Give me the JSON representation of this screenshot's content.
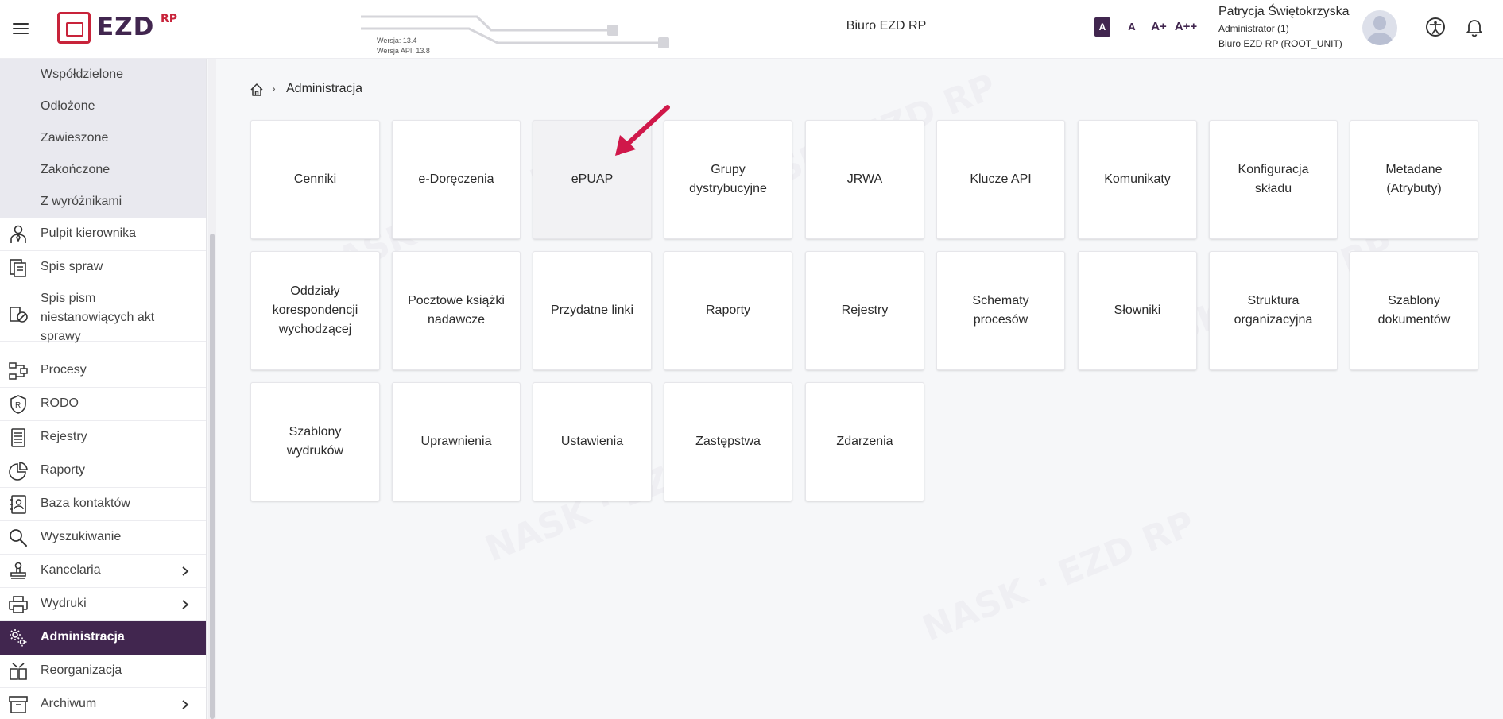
{
  "header": {
    "app_logo_text": "EZD",
    "app_logo_sup": "RP",
    "version": "Wersja: 13.4",
    "version_api": "Wersja API: 13.8",
    "organization": "Biuro EZD RP",
    "font_sizes": [
      "A",
      "A",
      "A+",
      "A++"
    ],
    "user": {
      "name": "Patrycja Świętokrzyska",
      "role": "Administrator (1)",
      "unit": "Biuro EZD RP (ROOT_UNIT)"
    },
    "icons": [
      "hamburger-icon",
      "accessibility-icon",
      "bell-icon"
    ]
  },
  "sidebar": {
    "sub_items": [
      "Współdzielone",
      "Odłożone",
      "Zawieszone",
      "Zakończone",
      "Z wyróżnikami"
    ],
    "items": [
      {
        "label": "Pulpit kierownika",
        "icon": "manager-icon",
        "chevron": false
      },
      {
        "label": "Spis spraw",
        "icon": "cases-icon",
        "chevron": false
      },
      {
        "label_lines": [
          "Spis pism",
          "niestanowiących akt",
          "sprawy"
        ],
        "icon": "documents-icon",
        "chevron": false
      },
      {
        "label": "Procesy",
        "icon": "process-icon",
        "chevron": false
      },
      {
        "label": "RODO",
        "icon": "shield-icon",
        "chevron": false
      },
      {
        "label": "Rejestry",
        "icon": "register-icon",
        "chevron": false
      },
      {
        "label": "Raporty",
        "icon": "pie-chart-icon",
        "chevron": false
      },
      {
        "label": "Baza kontaktów",
        "icon": "contacts-icon",
        "chevron": false
      },
      {
        "label": "Wyszukiwanie",
        "icon": "search-icon",
        "chevron": false
      },
      {
        "label": "Kancelaria",
        "icon": "stamp-icon",
        "chevron": true
      },
      {
        "label": "Wydruki",
        "icon": "printer-icon",
        "chevron": true
      },
      {
        "label": "Administracja",
        "icon": "gear-icon",
        "chevron": false,
        "active": true
      },
      {
        "label": "Reorganizacja",
        "icon": "reorganize-icon",
        "chevron": false
      },
      {
        "label": "Archiwum",
        "icon": "archive-icon",
        "chevron": true
      }
    ],
    "active_color": "#41264f"
  },
  "breadcrumb": {
    "separator": "›",
    "current": "Administracja"
  },
  "tiles": [
    {
      "lines": [
        "Cenniki"
      ]
    },
    {
      "lines": [
        "e-Doręczenia"
      ]
    },
    {
      "lines": [
        "ePUAP"
      ],
      "hover": true
    },
    {
      "lines": [
        "Grupy",
        "dystrybucyjne"
      ]
    },
    {
      "lines": [
        "JRWA"
      ]
    },
    {
      "lines": [
        "Klucze API"
      ]
    },
    {
      "lines": [
        "Komunikaty"
      ]
    },
    {
      "lines": [
        "Konfiguracja",
        "składu"
      ]
    },
    {
      "lines": [
        "Metadane",
        "(Atrybuty)"
      ]
    },
    {
      "lines": [
        "Oddziały",
        "korespondencji",
        "wychodzącej"
      ]
    },
    {
      "lines": [
        "Pocztowe książki",
        "nadawcze"
      ]
    },
    {
      "lines": [
        "Przydatne linki"
      ]
    },
    {
      "lines": [
        "Raporty"
      ]
    },
    {
      "lines": [
        "Rejestry"
      ]
    },
    {
      "lines": [
        "Schematy",
        "procesów"
      ]
    },
    {
      "lines": [
        "Słowniki"
      ]
    },
    {
      "lines": [
        "Struktura",
        "organizacyjna"
      ]
    },
    {
      "lines": [
        "Szablony",
        "dokumentów"
      ]
    },
    {
      "lines": [
        "Szablony",
        "wydruków"
      ]
    },
    {
      "lines": [
        "Uprawnienia"
      ]
    },
    {
      "lines": [
        "Ustawienia"
      ]
    },
    {
      "lines": [
        "Zastępstwa"
      ]
    },
    {
      "lines": [
        "Zdarzenia"
      ]
    }
  ],
  "colors": {
    "brand_purple": "#41264f",
    "brand_red": "#c8233a",
    "arrow": "#d0184a"
  }
}
